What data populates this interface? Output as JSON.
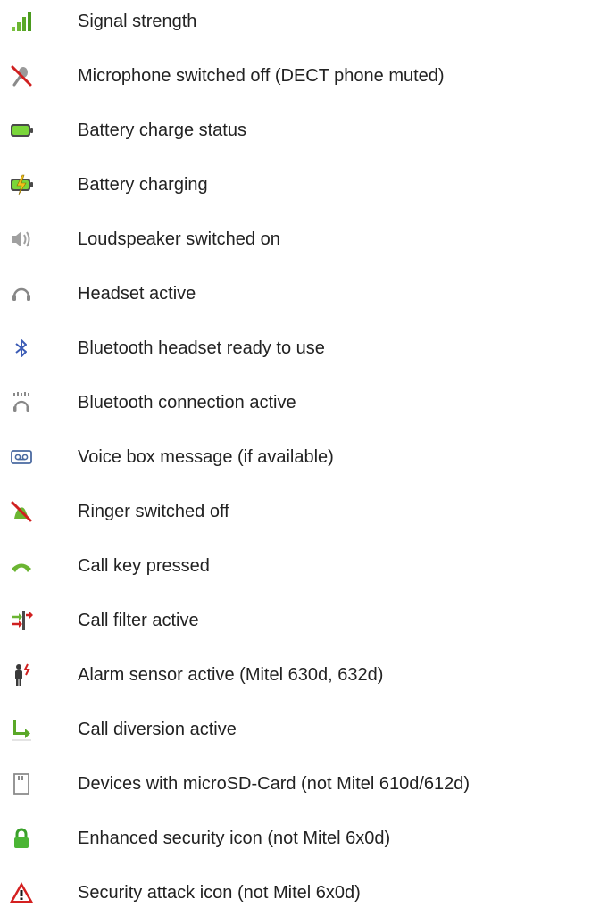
{
  "items": [
    {
      "icon": "signal-strength-icon",
      "label": "Signal strength"
    },
    {
      "icon": "microphone-off-icon",
      "label": "Microphone switched off (DECT phone muted)"
    },
    {
      "icon": "battery-icon",
      "label": "Battery charge status"
    },
    {
      "icon": "battery-charging-icon",
      "label": "Battery charging"
    },
    {
      "icon": "loudspeaker-icon",
      "label": "Loudspeaker switched on"
    },
    {
      "icon": "headset-icon",
      "label": "Headset active"
    },
    {
      "icon": "bluetooth-icon",
      "label": "Bluetooth headset ready to use"
    },
    {
      "icon": "bluetooth-connection-icon",
      "label": "Bluetooth connection active"
    },
    {
      "icon": "voicebox-icon",
      "label": "Voice box message (if available)"
    },
    {
      "icon": "ringer-off-icon",
      "label": "Ringer switched off"
    },
    {
      "icon": "call-key-icon",
      "label": "Call key pressed"
    },
    {
      "icon": "call-filter-icon",
      "label": "Call filter active"
    },
    {
      "icon": "alarm-sensor-icon",
      "label": "Alarm sensor active (Mitel 630d, 632d)"
    },
    {
      "icon": "call-diversion-icon",
      "label": "Call diversion active"
    },
    {
      "icon": "microsd-card-icon",
      "label": "Devices with microSD-Card (not Mitel 610d/612d)"
    },
    {
      "icon": "lock-icon",
      "label": "Enhanced security icon (not Mitel 6x0d)"
    },
    {
      "icon": "warning-icon",
      "label": "Security attack icon (not Mitel 6x0d)"
    }
  ],
  "colors": {
    "text": "#222222",
    "green": "#66bb22",
    "red": "#d02020",
    "grey": "#888888",
    "blue": "#3b5bb5"
  }
}
